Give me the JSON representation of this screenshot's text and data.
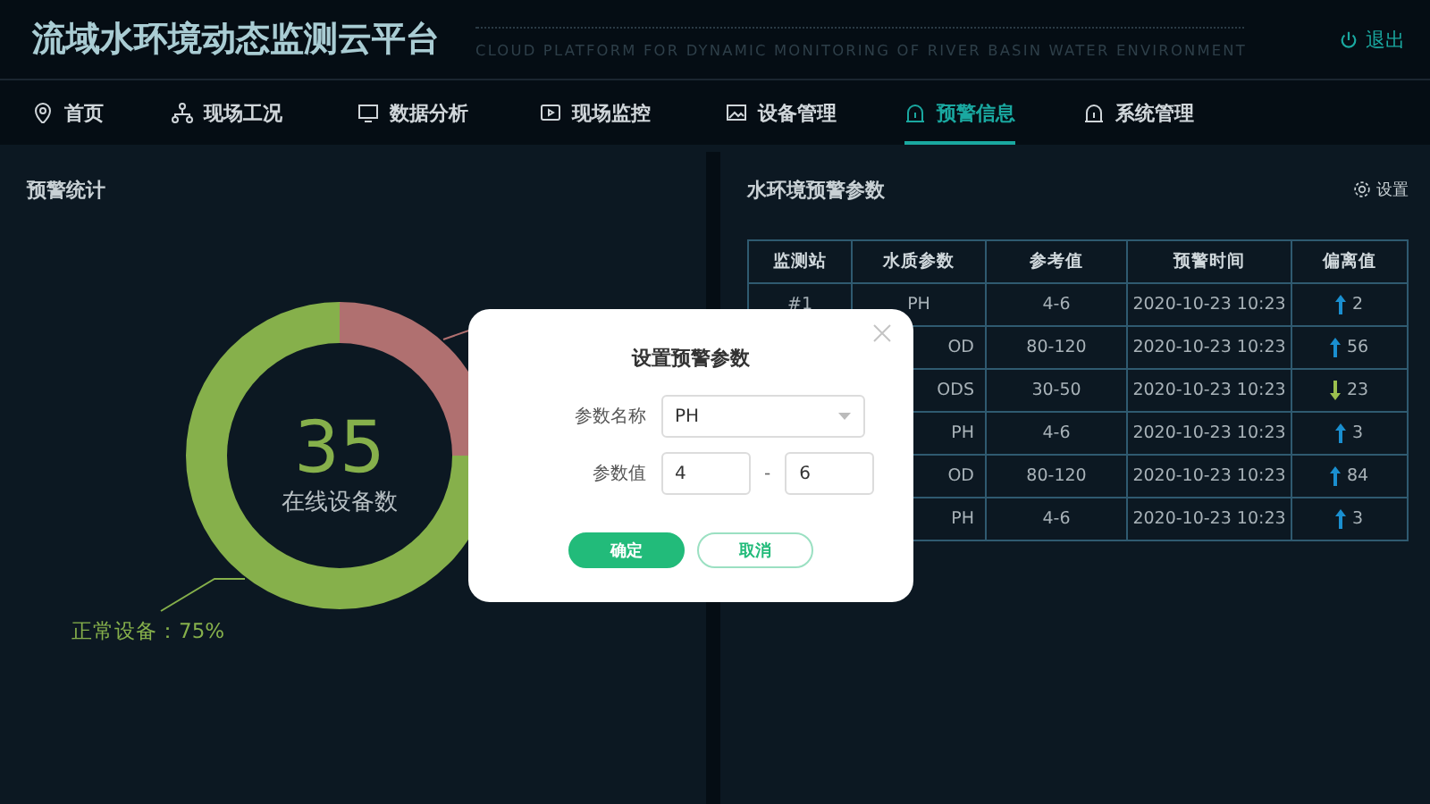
{
  "header": {
    "title": "流域水环境动态监测云平台",
    "subtitle": "CLOUD PLATFORM FOR DYNAMIC MONITORING OF RIVER BASIN WATER ENVIRONMENT",
    "logout": "退出"
  },
  "nav": [
    {
      "label": "首页",
      "selected": false
    },
    {
      "label": "现场工况",
      "selected": false
    },
    {
      "label": "数据分析",
      "selected": false
    },
    {
      "label": "现场监控",
      "selected": false
    },
    {
      "label": "设备管理",
      "selected": false
    },
    {
      "label": "预警信息",
      "selected": true
    },
    {
      "label": "系统管理",
      "selected": false
    }
  ],
  "stats_panel": {
    "title": "预警统计",
    "center_value": "35",
    "center_label": "在线设备数",
    "legend_label": "正常设备：75%",
    "chart_data": {
      "type": "donut",
      "values": [
        75,
        25
      ]
    }
  },
  "params_panel": {
    "title": "水环境预警参数",
    "settings": "设置",
    "table": {
      "columns": [
        "监测站",
        "水质参数",
        "参考值",
        "预警时间",
        "偏离值"
      ],
      "rows": [
        {
          "station": "#1",
          "param": "PH",
          "reference": "4-6",
          "time": "2020-10-23  10:23",
          "kind": "up",
          "deviation": "2"
        },
        {
          "param": "OD",
          "reference": "80-120",
          "time": "2020-10-23  10:23",
          "kind": "up",
          "deviation": "56"
        },
        {
          "param": "ODS",
          "reference": "30-50",
          "time": "2020-10-23  10:23",
          "kind": "down",
          "deviation": "23"
        },
        {
          "param": "PH",
          "reference": "4-6",
          "time": "2020-10-23  10:23",
          "kind": "up",
          "deviation": "3"
        },
        {
          "param": "OD",
          "reference": "80-120",
          "time": "2020-10-23  10:23",
          "kind": "up",
          "deviation": "84"
        },
        {
          "param": "PH",
          "reference": "4-6",
          "time": "2020-10-23  10:23",
          "kind": "up",
          "deviation": "3"
        }
      ]
    }
  },
  "dialog": {
    "title": "设置预警参数",
    "name_label": "参数名称",
    "name_value": "PH",
    "value_label": "参数值",
    "min": "4",
    "separator": "-",
    "max": "6",
    "confirm": "确定",
    "cancel": "取消"
  }
}
